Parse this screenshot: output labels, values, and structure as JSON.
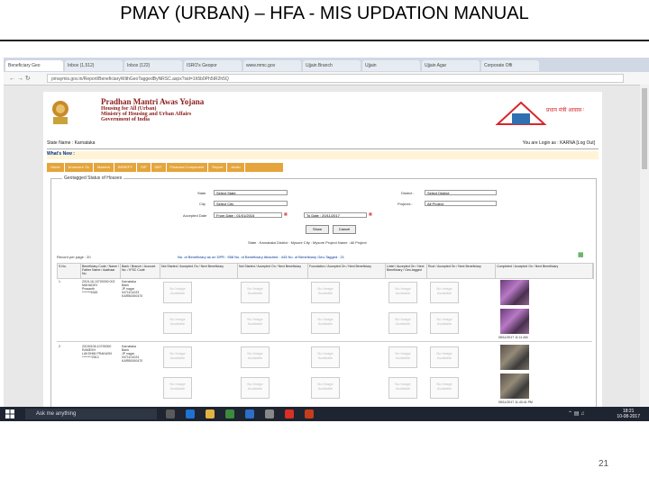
{
  "slide": {
    "title": "PMAY (URBAN) – HFA - MIS UPDATION MANUAL",
    "page_number": "21"
  },
  "browser": {
    "tabs": [
      "Beneficiary Geo",
      "Inbox (1,512)",
      "Inbox (122)",
      "ISRO's Geopor",
      "www.mmc.gov",
      "Ujjain Branch",
      "Ujjain",
      "Ujjain Agar",
      "Corporate Offi"
    ],
    "address": "pmaymis.gov.in/Report/BeneficiaryWithGeoTaggedByNRSC.aspx?sid=1h5b0Ph5tR2h5Q"
  },
  "header": {
    "line1": "Pradhan Mantri Awas Yojana",
    "line2": "Housing for All (Urban)",
    "line3": "Ministry of Housing and Urban Affairs",
    "line4": "Government of India",
    "logo_text": "प्रधान मंत्री आवास योजना"
  },
  "statebar": {
    "left": "State Name : Karnataka",
    "right": "You are Login as : KARNA  [Log Out]"
  },
  "whats_new": "What's New :",
  "menu": [
    "Home",
    "Annexure 7A",
    "Masters",
    "BENEFY",
    "SIP",
    "DBT",
    "Financial Component",
    "Report",
    "Audio"
  ],
  "form": {
    "legend": "Geotagged Status of Houses",
    "state_label": "State",
    "state_value": "Select State",
    "district_label": "District :",
    "district_value": "Select District",
    "city_label": "City",
    "city_value": "Select City",
    "projects_label": "Projects :",
    "projects_value": "All Project",
    "accepted_label": "Accepted Date",
    "from_value": "From Date : 01/01/2015",
    "to_value": "To Date : 20/11/2017",
    "show_label": "Show",
    "cancel_label": "Cancel",
    "filter_info": "State : Karnataka    District : Mysore    City : Mysore    Project Name : All Project"
  },
  "table": {
    "per_page": "Record per page :  20",
    "summary": "No. of Beneficiary as on DPR : 558    No. of Beneficiary Attached : 443    No. of Beneficiary Geo-Tagged : 21",
    "headers": [
      "S.No.",
      "Beneficiary Code / Name / Father Name / Aadhaar No.",
      "Bank / Branch / Account No. / IFSC Code",
      "Not Started / Accepted On / Next Beneficiary",
      "Not Started / Accepted On / Next Beneficiary",
      "Foundation / Accepted On / Next Beneficiary",
      "Lintel / Accepted On / Next Beneficiary / Geo-tagged",
      "Roof / Accepted On / Next Beneficiary",
      "Completed / Accepted On / Next Beneficiary"
    ],
    "rows": [
      {
        "sno": "1",
        "code": "2015-16-10700000 002\nMAHADEV\nPrasanth\n*******5345",
        "bank": "Karnataka\nBank\nJP nagar\n0471101023\nKARB0000470",
        "stamp": "05/11/2017 11:11 AM"
      },
      {
        "sno": "2",
        "code": "20150106-10700000\nRAMESH\nLAKSHMI PRAKASH\n********2512",
        "bank": "Karnataka\nBank\nJP nagar\n0471101024\nKARB0000470",
        "stamp": "05/11/2017 11:43:41 PM"
      }
    ],
    "no_image": "No Image Available"
  },
  "taskbar": {
    "search": "Ask me anything",
    "time": "18:21",
    "date": "10-08-2017"
  },
  "colors": {
    "menu_bar": "#e5a53c",
    "brand_red": "#8b1a1a",
    "taskbar": "#1e2430"
  }
}
